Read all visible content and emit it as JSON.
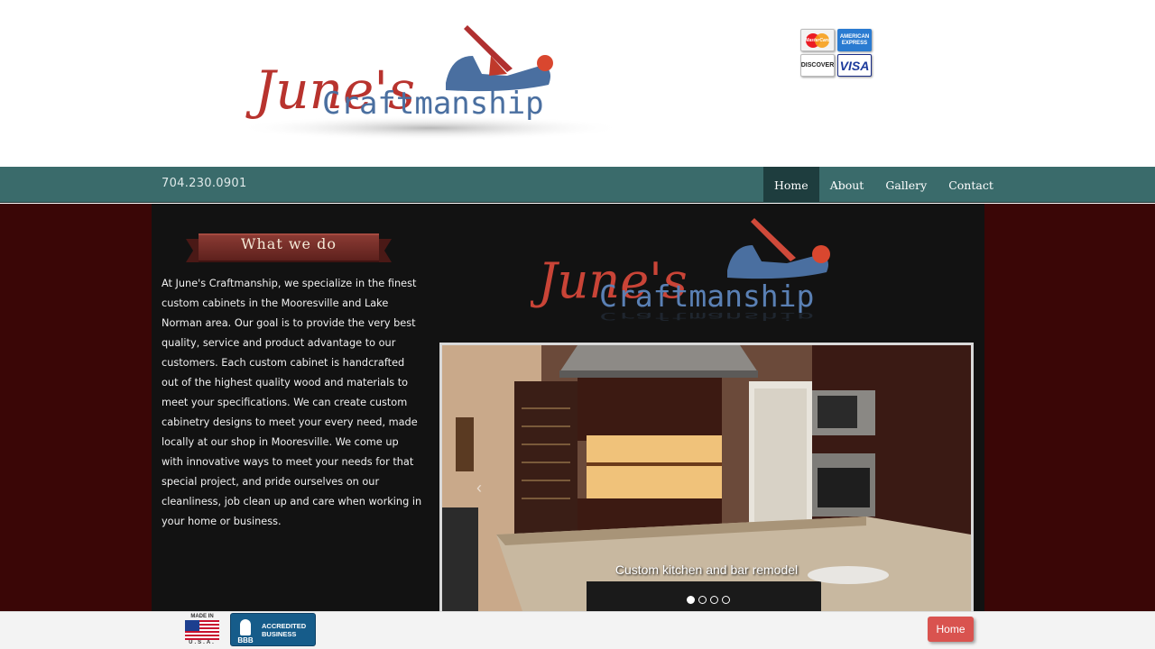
{
  "header": {
    "logo_alt": "June's Craftmanship",
    "logo_line1": "June's",
    "logo_line2": "Craftmanship",
    "payment_cards": [
      {
        "name": "MasterCard",
        "label": "MasterCard"
      },
      {
        "name": "American Express",
        "label": "AMERICAN EXPRESS"
      },
      {
        "name": "Discover",
        "label": "DISCOVER"
      },
      {
        "name": "Visa",
        "label": "VISA"
      }
    ]
  },
  "navbar": {
    "phone": "704.230.0901",
    "items": [
      {
        "label": "Home",
        "active": true
      },
      {
        "label": "About",
        "active": false
      },
      {
        "label": "Gallery",
        "active": false
      },
      {
        "label": "Contact",
        "active": false
      }
    ]
  },
  "main": {
    "section_title": "What we do",
    "body": "At June's Craftmanship, we specialize in the finest custom cabinets in the Mooresville and Lake Norman area. Our goal is to provide the very best quality, service and product advantage to our customers. Each custom cabinet is handcrafted out of the highest quality wood and materials to meet your specifications. We can create custom cabinetry designs to meet your every need, made locally at our shop in Mooresville. We come up with innovative ways to meet your needs for that special project, and pride ourselves on our cleanliness, job clean up and care when working in your home or business.",
    "slider": {
      "caption": "Custom kitchen and bar remodel",
      "slide_count": 4,
      "active_slide": 1,
      "prev_arrow": "‹"
    }
  },
  "footer": {
    "made_in_top": "MADE IN",
    "made_in_bottom": "U.S.A.",
    "bbb_mark": "BBB",
    "bbb_line1": "ACCREDITED",
    "bbb_line2": "BUSINESS",
    "home_button": "Home"
  },
  "colors": {
    "navbar": "#3a6b6b",
    "nav_active": "#1e3d3e",
    "content_bg": "#121212",
    "side_bg": "#3a0606",
    "logo_red": "#c0392b",
    "logo_blue": "#4a6fa0",
    "home_button": "#d9534f"
  }
}
